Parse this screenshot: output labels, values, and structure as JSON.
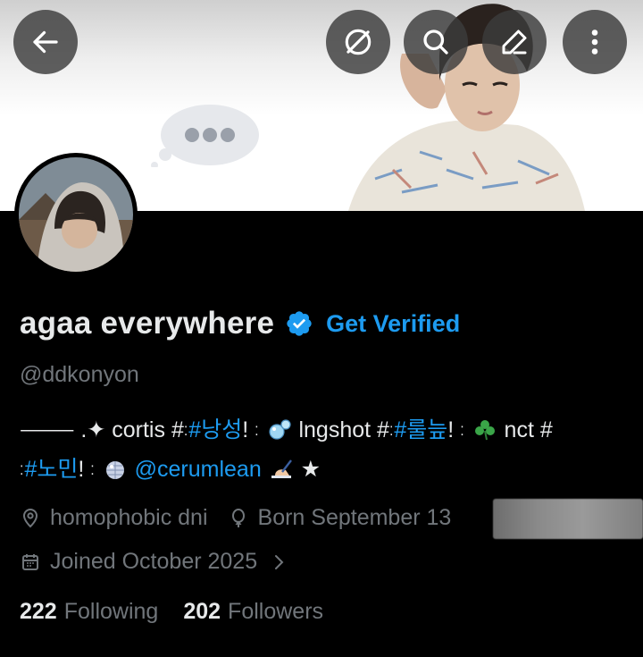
{
  "header": {
    "back_icon": "arrow-left-icon",
    "unfollow_icon": "slashed-circle-icon",
    "search_icon": "search-icon",
    "edit_icon": "pencil-icon",
    "more_icon": "vertical-dots-icon"
  },
  "profile": {
    "display_name": "agaa everywhere",
    "get_verified_label": "Get Verified",
    "handle": "@ddkonyon",
    "bio": {
      "seg1": "⸻ .✦ cortis ",
      "tag1": "#낭성",
      "seg2": "! ",
      "seg3": " lngshot ",
      "tag2": "#룰늪",
      "seg4": "! ",
      "seg5": " nct ",
      "tag3": "#노민",
      "seg6": "! ",
      "mention": "@cerumlean",
      "seg7": " ★",
      "hash": "#",
      "dots": "⁚"
    },
    "location": "homophobic dni",
    "birthday": "Born September 13",
    "joined": "Joined October 2025",
    "following_count": "222",
    "following_label": "Following",
    "followers_count": "202",
    "followers_label": "Followers"
  },
  "colors": {
    "accent": "#1d9bf0",
    "text_primary": "#e7e9ea",
    "text_secondary": "#71767b",
    "background": "#000000"
  }
}
